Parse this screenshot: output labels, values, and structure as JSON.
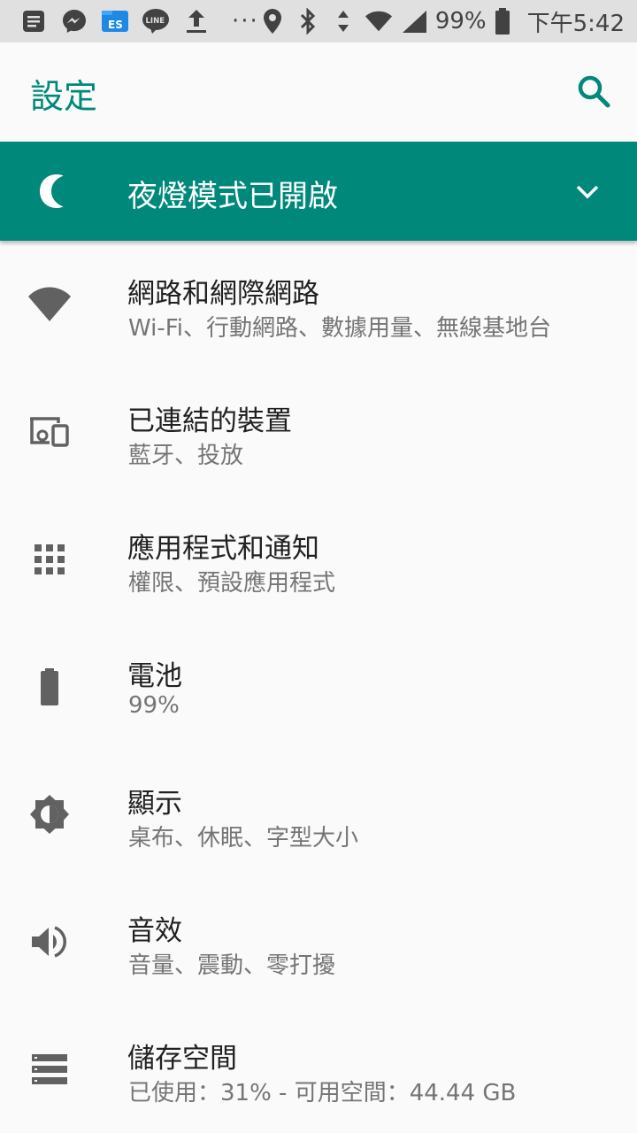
{
  "status_bar": {
    "icons": [
      "notes-icon",
      "messenger-icon",
      "file-explorer-icon",
      "line-icon",
      "upload-icon",
      "more-dots-icon",
      "location-icon",
      "bluetooth-icon",
      "data-transfer-icon",
      "wifi-icon",
      "signal-icon",
      "battery-icon"
    ],
    "battery": "99%",
    "time": "下午5:42",
    "more": "···"
  },
  "appbar": {
    "title": "設定",
    "search_icon": "search-icon"
  },
  "banner": {
    "text": "夜燈模式已開啟",
    "icon": "moon-icon",
    "chevron": "chevron-down-icon"
  },
  "items": [
    {
      "title": "網路和網際網路",
      "subtitle": "Wi-Fi、行動網路、數據用量、無線基地台",
      "icon": "wifi-icon"
    },
    {
      "title": "已連結的裝置",
      "subtitle": "藍牙、投放",
      "icon": "devices-icon"
    },
    {
      "title": "應用程式和通知",
      "subtitle": "權限、預設應用程式",
      "icon": "apps-icon"
    },
    {
      "title": "電池",
      "subtitle": "99%",
      "icon": "battery-icon"
    },
    {
      "title": "顯示",
      "subtitle": "桌布、休眠、字型大小",
      "icon": "brightness-icon"
    },
    {
      "title": "音效",
      "subtitle": "音量、震動、零打擾",
      "icon": "volume-icon"
    },
    {
      "title": "儲存空間",
      "subtitle": "已使用：31% - 可用空間：44.44 GB",
      "icon": "storage-icon"
    }
  ],
  "colors": {
    "accent": "#00897b",
    "statusbar": "#e0e0e0",
    "background": "#fafafa",
    "icon": "#616161"
  }
}
